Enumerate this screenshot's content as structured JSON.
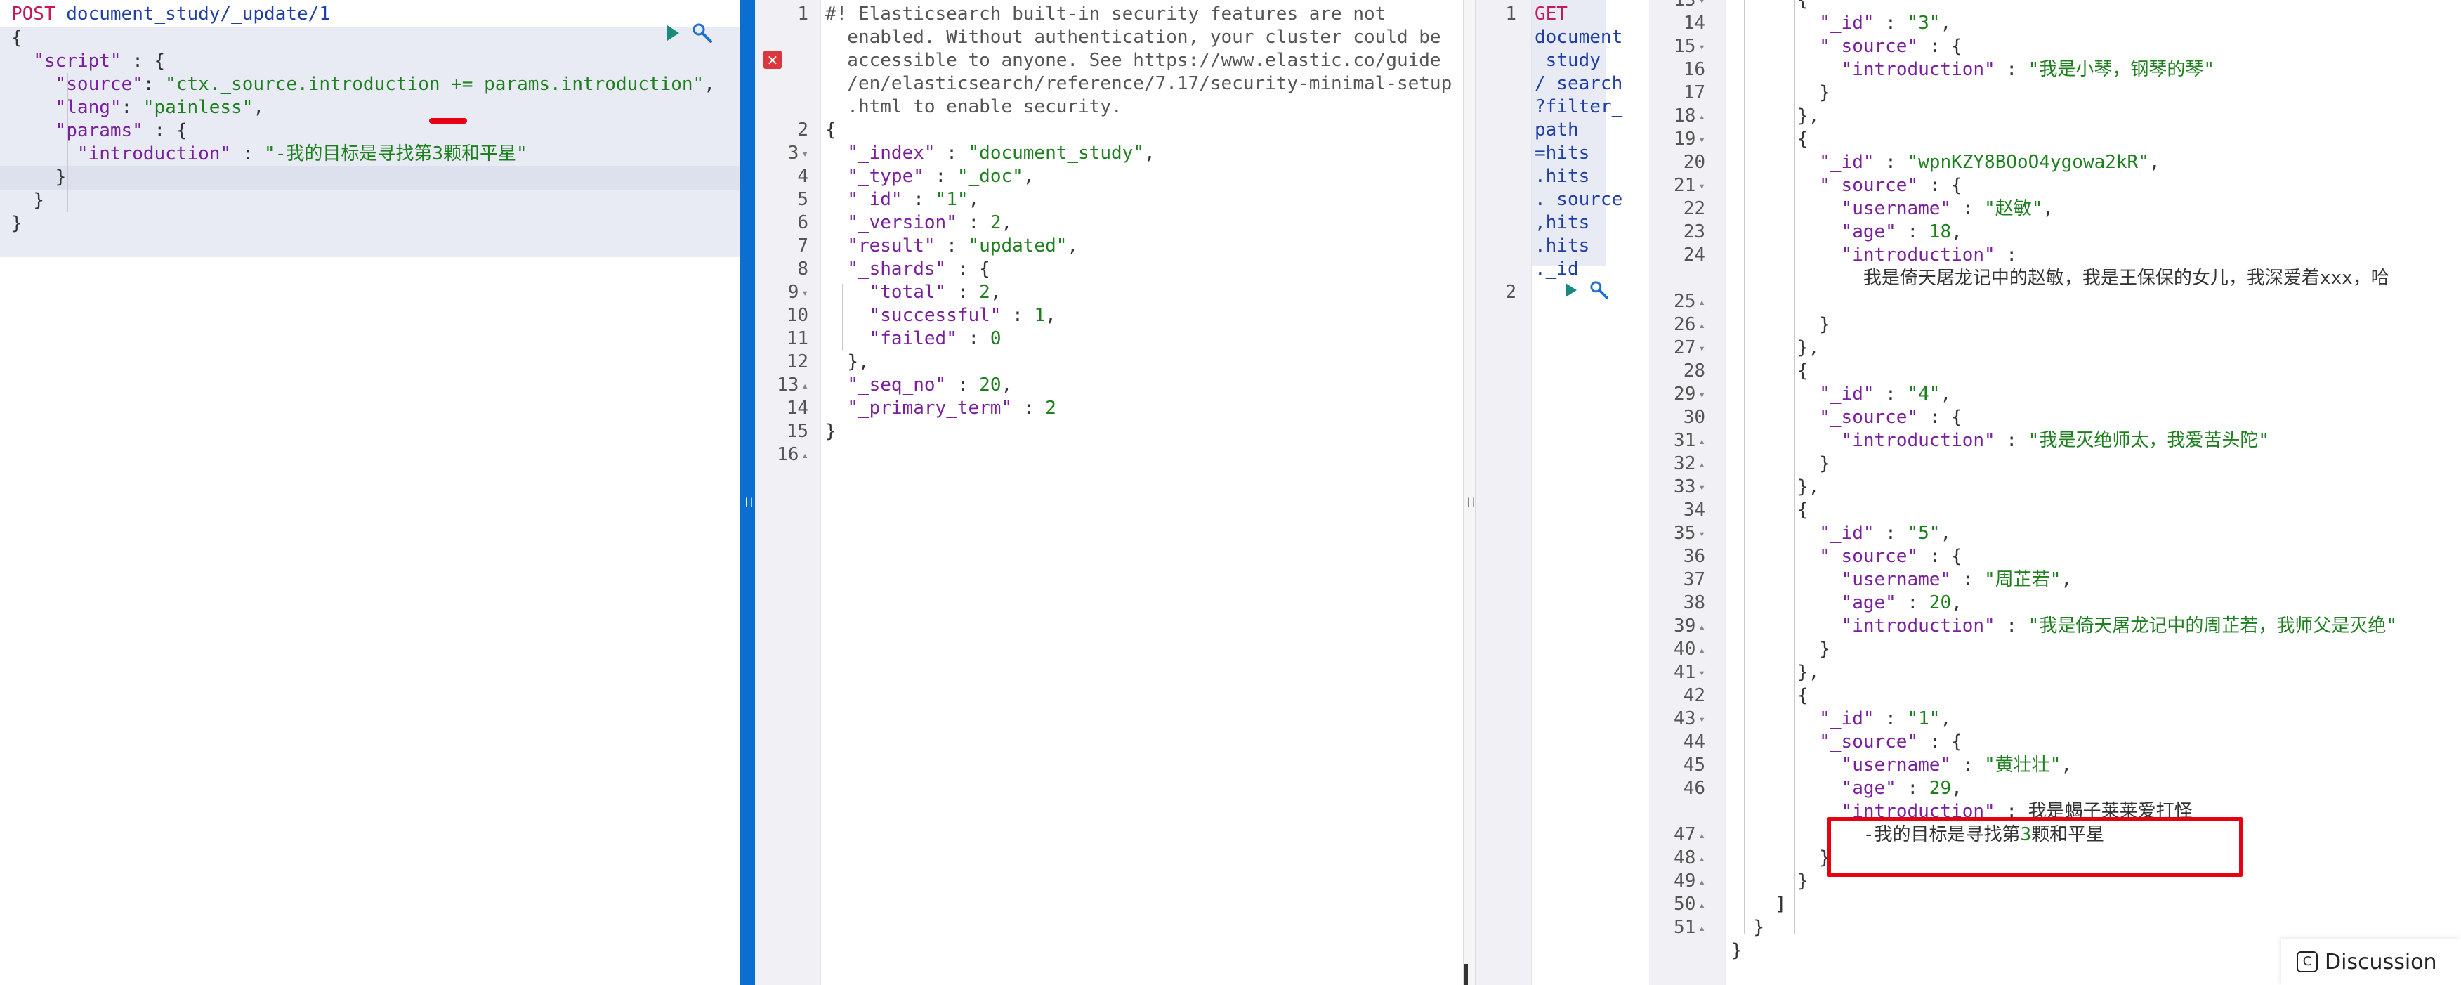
{
  "request_editor": {
    "method": "POST",
    "url": "document_study/_update/1",
    "lines": [
      "{",
      "  \"script\" : {",
      "    \"source\": \"ctx._source.introduction += params.introduction\",",
      "    \"lang\": \"painless\",",
      "    \"params\" : {",
      "      \"introduction\" : \"-我的目标是寻找第3颗和平星\"",
      "    }",
      "  }",
      "}"
    ]
  },
  "response_panel": {
    "line_numbers": [
      "1",
      "2",
      "3",
      "4",
      "5",
      "6",
      "7",
      "8",
      "9",
      "10",
      "11",
      "12",
      "13",
      "14",
      "15",
      "16"
    ],
    "warning_lines": [
      "#! Elasticsearch built-in security features are not",
      "enabled. Without authentication, your cluster could be",
      "accessible to anyone. See https://www.elastic.co/guide",
      "/en/elasticsearch/reference/7.17/security-minimal-setup",
      ".html to enable security."
    ],
    "body_lines": [
      "{",
      "  \"_index\" : \"document_study\",",
      "  \"_type\" : \"_doc\",",
      "  \"_id\" : \"1\",",
      "  \"_version\" : 2,",
      "  \"result\" : \"updated\",",
      "  \"_shards\" : {",
      "    \"total\" : 2,",
      "    \"successful\" : 1,",
      "    \"failed\" : 0",
      "  },",
      "  \"_seq_no\" : 20,",
      "  \"_primary_term\" : 2",
      "}",
      ""
    ]
  },
  "search_editor": {
    "line_numbers": [
      "1",
      "2"
    ],
    "get_fragments": [
      "GET",
      "document",
      "_study",
      "/_search",
      "?filter_",
      "path",
      "=hits",
      ".hits",
      "._source",
      ",hits",
      ".hits",
      "._id"
    ]
  },
  "search_response": {
    "line_numbers": [
      "13",
      "14",
      "15",
      "16",
      "17",
      "18",
      "19",
      "20",
      "21",
      "22",
      "23",
      "24",
      "",
      "25",
      "26",
      "27",
      "28",
      "29",
      "30",
      "31",
      "32",
      "33",
      "34",
      "35",
      "36",
      "37",
      "38",
      "39",
      "40",
      "41",
      "42",
      "43",
      "44",
      "45",
      "46",
      "",
      "47",
      "48",
      "49",
      "50",
      "51"
    ],
    "lines": [
      "      {",
      "        \"_id\" : \"3\",",
      "        \"_source\" : {",
      "          \"introduction\" : \"我是小琴，钢琴的琴\"",
      "        }",
      "      },",
      "      {",
      "        \"_id\" : \"wpnKZY8BOoO4ygowa2kR\",",
      "        \"_source\" : {",
      "          \"username\" : \"赵敏\",",
      "          \"age\" : 18,",
      "          \"introduction\" :",
      "            \"我是倚天屠龙记中的赵敏，我是王保保的女儿，我深爱着xxx，哈",
      "            \"",
      "        }",
      "      },",
      "      {",
      "        \"_id\" : \"4\",",
      "        \"_source\" : {",
      "          \"introduction\" : \"我是灭绝师太，我爱苦头陀\"",
      "        }",
      "      },",
      "      {",
      "        \"_id\" : \"5\",",
      "        \"_source\" : {",
      "          \"username\" : \"周芷若\",",
      "          \"age\" : 20,",
      "          \"introduction\" : \"我是倚天屠龙记中的周芷若，我师父是灭绝\"",
      "        }",
      "      },",
      "      {",
      "        \"_id\" : \"1\",",
      "        \"_source\" : {",
      "          \"username\" : \"黄壮壮\",",
      "          \"age\" : 29,",
      "          \"introduction\" : \"我是蝎子莱莱爱打怪",
      "            -我的目标是寻找第3颗和平星\"",
      "        }",
      "      }",
      "    ]",
      "  }",
      "}"
    ]
  },
  "discussion": {
    "label": "Discussion"
  },
  "colors": {
    "method": "#c41a5b",
    "url": "#1f3fa6",
    "string": "#1d7f1d",
    "key": "#7a1f9e",
    "divider_blue": "#0a6fd1",
    "highlight_red": "#e60012"
  },
  "icons": [
    "play-icon",
    "wrench-icon",
    "error-icon",
    "discussion-icon"
  ]
}
